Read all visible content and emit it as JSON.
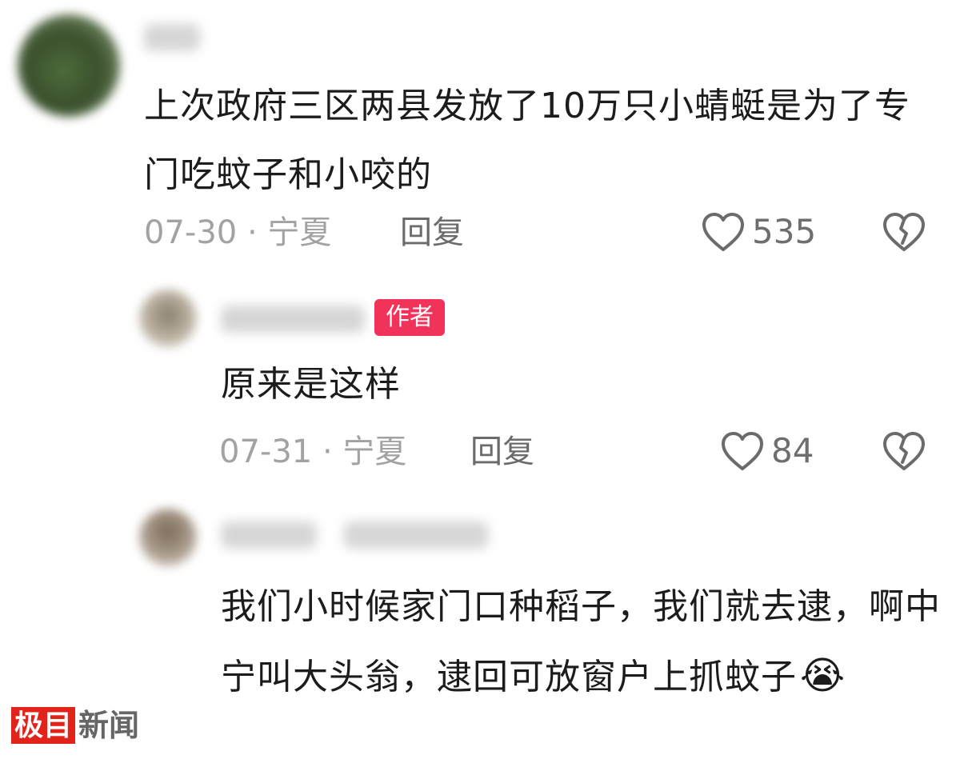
{
  "comments": [
    {
      "text": "上次政府三区两县发放了10万只小蜻蜓是为了专门吃蚊子和小咬的",
      "meta": "07-30 · 宁夏",
      "reply": "回复",
      "likes": "535"
    },
    {
      "badge": "作者",
      "text": "原来是这样",
      "meta": "07-31 · 宁夏",
      "reply": "回复",
      "likes": "84"
    },
    {
      "text": "我们小时候家门口种稻子，我们就去逮，啊中宁叫大头翁，逮回可放窗户上抓蚊子",
      "emoji": "😭"
    }
  ],
  "watermark": {
    "part1": "极目",
    "part2": "新闻"
  },
  "colors": {
    "badge": "#f1335a",
    "meta": "#a2a2a2",
    "watermark_red": "#e2231a"
  }
}
